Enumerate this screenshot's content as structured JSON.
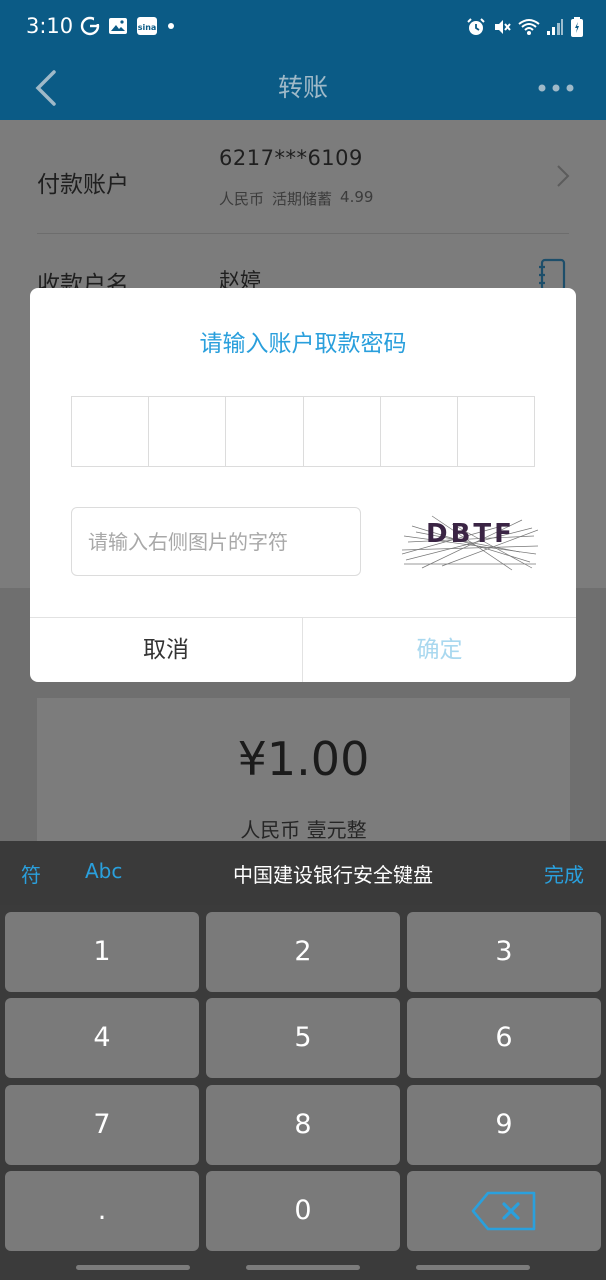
{
  "status_bar": {
    "time": "3:10",
    "left_icons": [
      "google-icon",
      "image-icon",
      "sina-icon",
      "dot-icon"
    ],
    "right_icons": [
      "alarm-icon",
      "mute-icon",
      "wifi-icon",
      "signal-icon",
      "battery-icon"
    ]
  },
  "app_bar": {
    "title": "转账"
  },
  "payer": {
    "label": "付款账户",
    "card": "6217***6109",
    "currency": "人民币",
    "account_type": "活期储蓄",
    "balance": "4.99"
  },
  "payee": {
    "label": "收款户名",
    "name": "赵婷"
  },
  "amount": {
    "value": "¥1.00",
    "words": "人民币 壹元整"
  },
  "dialog": {
    "title": "请输入账户取款密码",
    "captcha_placeholder": "请输入右侧图片的字符",
    "captcha_text": "DBTF",
    "cancel": "取消",
    "confirm": "确定"
  },
  "keyboard": {
    "sym": "符",
    "abc": "Abc",
    "title": "中国建设银行安全键盘",
    "done": "完成",
    "keys": [
      "1",
      "2",
      "3",
      "4",
      "5",
      "6",
      "7",
      "8",
      "9",
      ".",
      "0"
    ]
  },
  "colors": {
    "app_bar": "#0b5b86",
    "accent": "#2a9fdc",
    "confirm_disabled": "#a9d8ef",
    "keyboard_bg": "#3b3b3b",
    "key_bg": "#7a7a7a"
  }
}
